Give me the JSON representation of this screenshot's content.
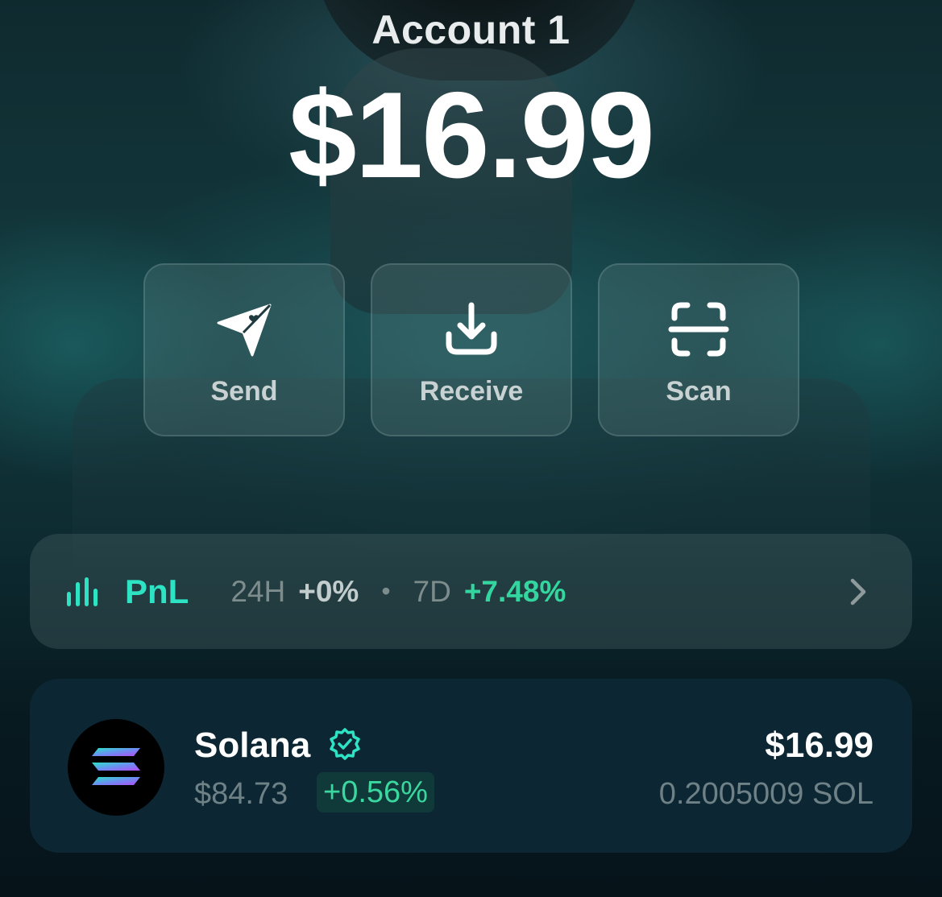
{
  "header": {
    "account_name": "Account 1",
    "total_balance": "$16.99"
  },
  "actions": [
    {
      "label": "Send",
      "icon": "send-plane-icon"
    },
    {
      "label": "Receive",
      "icon": "download-icon"
    },
    {
      "label": "Scan",
      "icon": "scan-icon"
    }
  ],
  "pnl": {
    "label": "PnL",
    "icon": "bar-chart-icon",
    "period_24h": "24H",
    "value_24h": "+0%",
    "separator": "•",
    "period_7d": "7D",
    "value_7d": "+7.48%"
  },
  "tokens": [
    {
      "name": "Solana",
      "verified": true,
      "price": "$84.73",
      "change": "+0.56%",
      "value": "$16.99",
      "amount": "0.2005009 SOL"
    }
  ],
  "colors": {
    "accent": "#2ee3c4",
    "positive": "#33d69f",
    "muted": "#7d8c8d",
    "card": "#0c2733"
  }
}
